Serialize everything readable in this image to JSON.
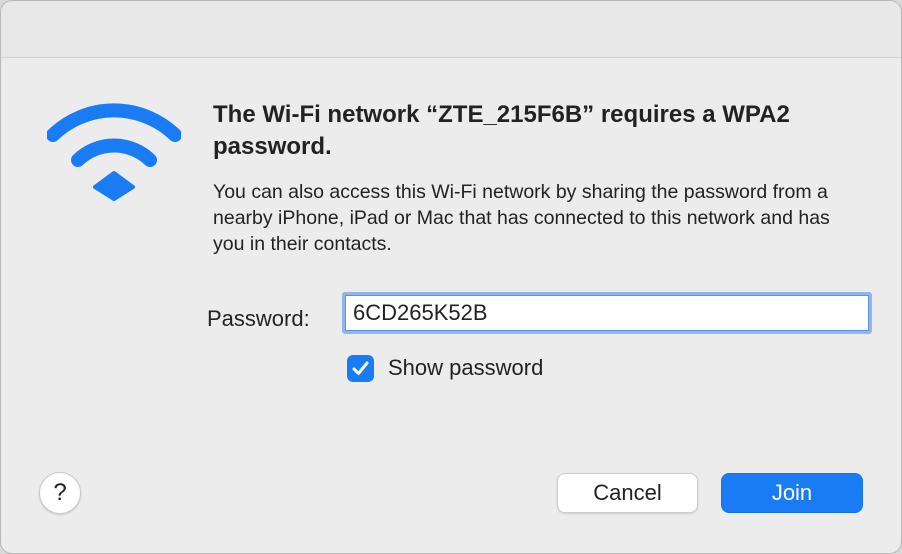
{
  "dialog": {
    "heading": "The Wi-Fi network “ZTE_215F6B” requires a WPA2 password.",
    "description": "You can also access this Wi-Fi network by sharing the password from a nearby iPhone, iPad or Mac that has connected to this network and has you in their contacts.",
    "password_label": "Password:",
    "password_value": "6CD265K52B",
    "show_password_label": "Show password",
    "show_password_checked": true,
    "help_label": "?",
    "cancel_label": "Cancel",
    "join_label": "Join"
  },
  "icons": {
    "wifi": "wifi-icon",
    "checkmark": "checkmark-icon"
  },
  "colors": {
    "accent": "#1a7cf5",
    "background": "#ececec",
    "text": "#222222"
  }
}
